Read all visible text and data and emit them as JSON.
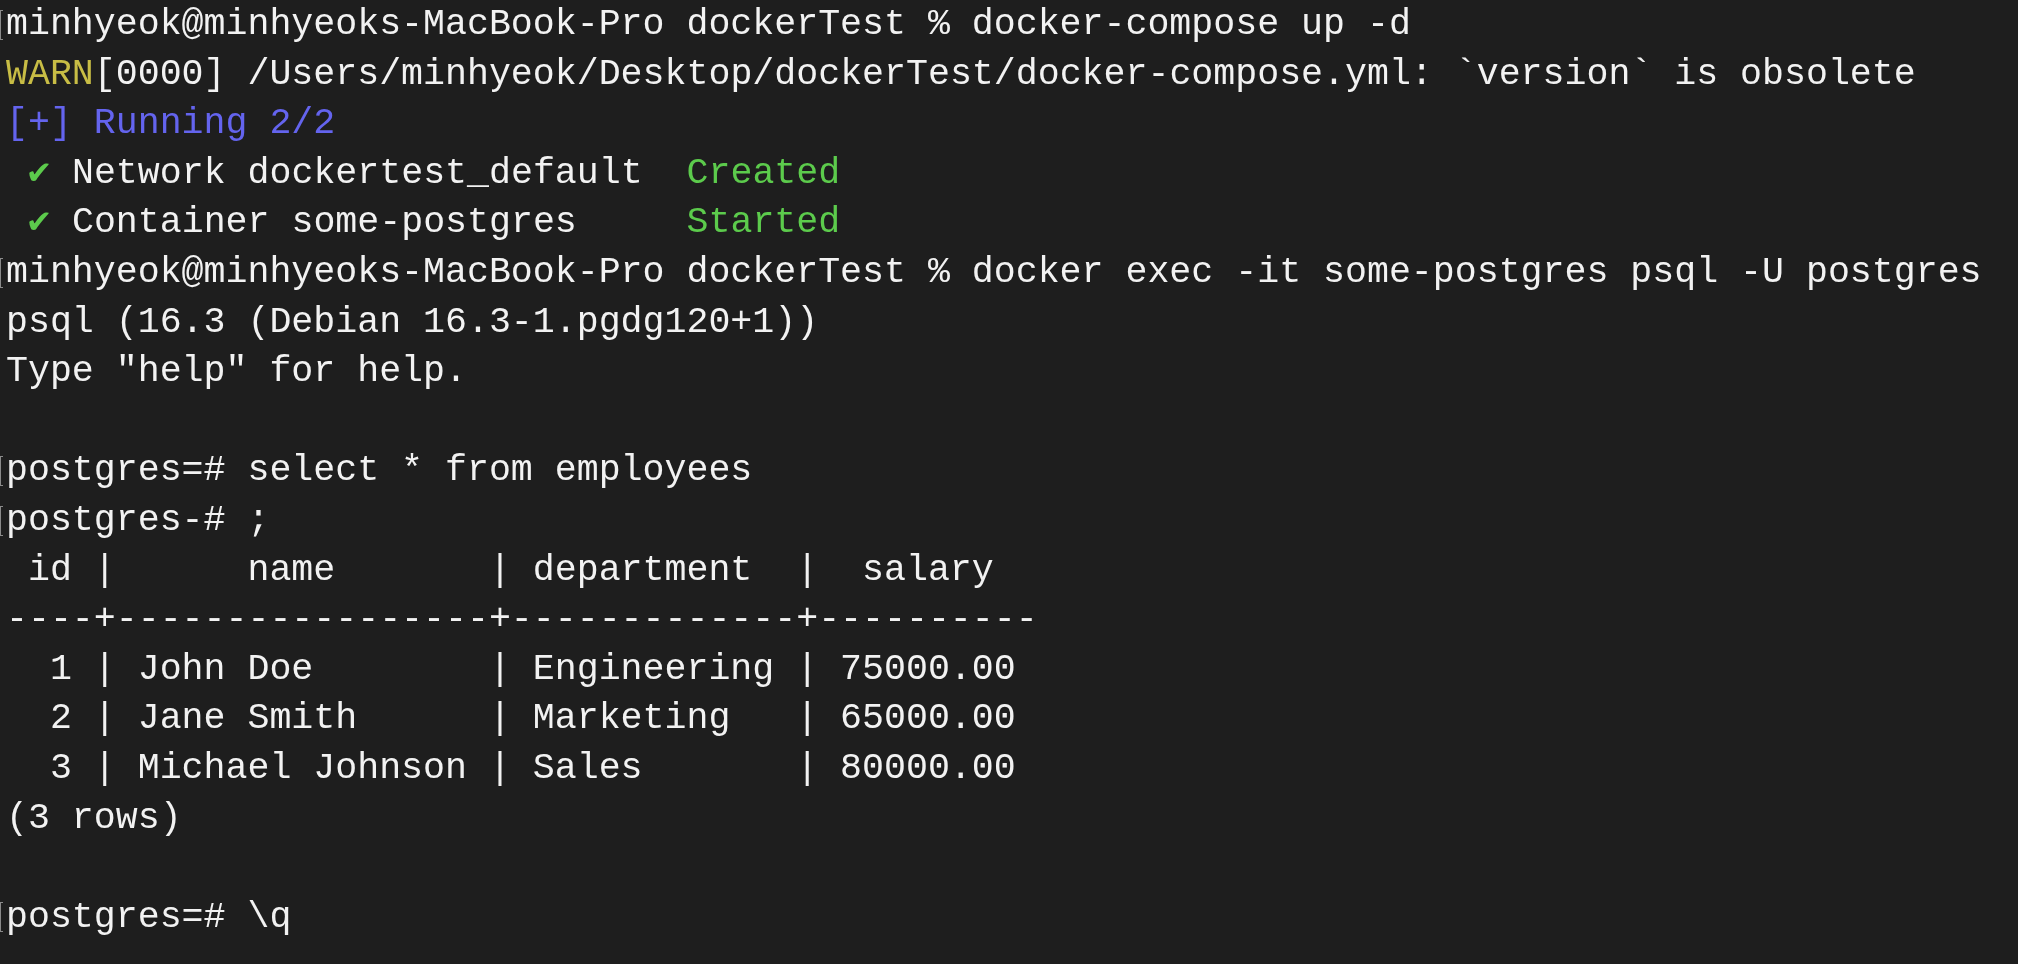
{
  "terminal": {
    "lines": [
      {
        "marked": true,
        "segments": [
          {
            "kind": "plain",
            "text": "minhyeok@minhyeoks-MacBook-Pro dockerTest % docker-compose up -d"
          }
        ]
      },
      {
        "marked": false,
        "segments": [
          {
            "kind": "warn",
            "text": "WARN"
          },
          {
            "kind": "plain",
            "text": "[0000] /Users/minhyeok/Desktop/dockerTest/docker-compose.yml: `version` is obsolete"
          }
        ]
      },
      {
        "marked": false,
        "segments": [
          {
            "kind": "info",
            "text": "[+] Running 2/2"
          }
        ]
      },
      {
        "marked": false,
        "indent": true,
        "segments": [
          {
            "kind": "check",
            "text": "✔"
          },
          {
            "kind": "plain",
            "text": " Network dockertest_default  "
          },
          {
            "kind": "success",
            "text": "Created"
          }
        ]
      },
      {
        "marked": false,
        "indent": true,
        "segments": [
          {
            "kind": "check",
            "text": "✔"
          },
          {
            "kind": "plain",
            "text": " Container some-postgres     "
          },
          {
            "kind": "success",
            "text": "Started"
          }
        ]
      },
      {
        "marked": true,
        "segments": [
          {
            "kind": "plain",
            "text": "minhyeok@minhyeoks-MacBook-Pro dockerTest % docker exec -it some-postgres psql -U postgres"
          }
        ]
      },
      {
        "marked": false,
        "segments": [
          {
            "kind": "plain",
            "text": "psql (16.3 (Debian 16.3-1.pgdg120+1))"
          }
        ]
      },
      {
        "marked": false,
        "segments": [
          {
            "kind": "plain",
            "text": "Type \"help\" for help."
          }
        ]
      },
      {
        "marked": false
      },
      {
        "marked": true,
        "segments": [
          {
            "kind": "plain",
            "text": "postgres=# select * from employees"
          }
        ]
      },
      {
        "marked": true,
        "segments": [
          {
            "kind": "plain",
            "text": "postgres-# ;"
          }
        ]
      },
      {
        "marked": false,
        "segments": [
          {
            "kind": "plain",
            "text": " id |      name       | department  |  salary"
          }
        ]
      },
      {
        "marked": false,
        "segments": [
          {
            "kind": "plain",
            "text": "----+-----------------+-------------+----------"
          }
        ]
      },
      {
        "marked": false,
        "segments": [
          {
            "kind": "plain",
            "text": "  1 | John Doe        | Engineering | 75000.00"
          }
        ]
      },
      {
        "marked": false,
        "segments": [
          {
            "kind": "plain",
            "text": "  2 | Jane Smith      | Marketing   | 65000.00"
          }
        ]
      },
      {
        "marked": false,
        "segments": [
          {
            "kind": "plain",
            "text": "  3 | Michael Johnson | Sales       | 80000.00"
          }
        ]
      },
      {
        "marked": false,
        "segments": [
          {
            "kind": "plain",
            "text": "(3 rows)"
          }
        ]
      },
      {
        "marked": false
      },
      {
        "marked": true,
        "segments": [
          {
            "kind": "plain",
            "text": "postgres=# \\q"
          }
        ]
      }
    ]
  }
}
